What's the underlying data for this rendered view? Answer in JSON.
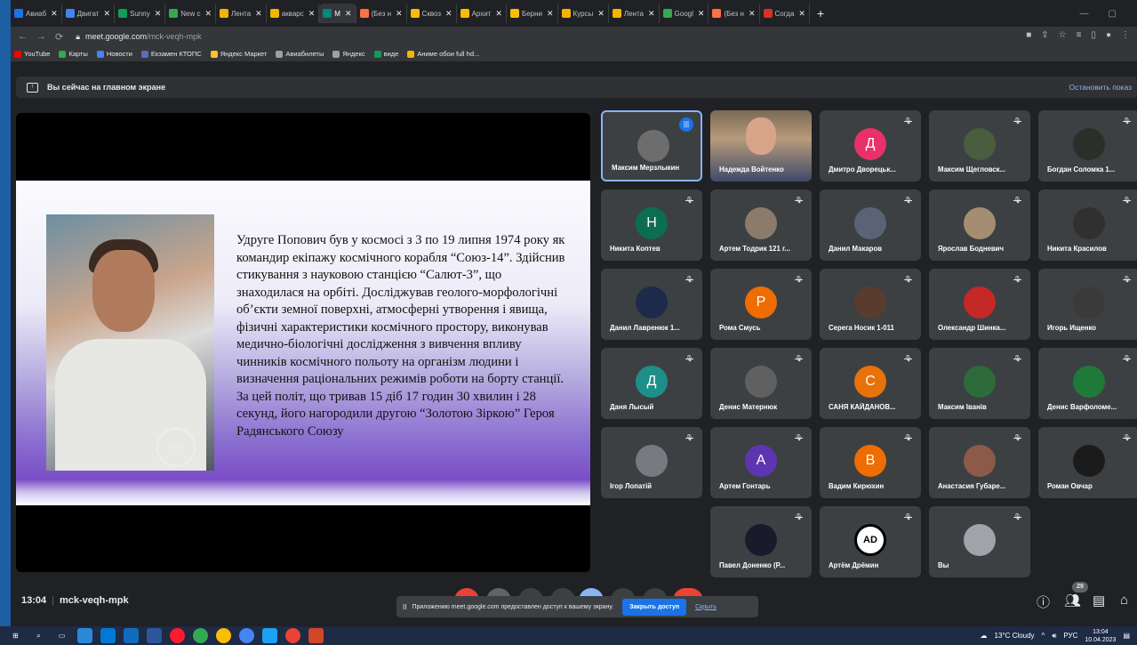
{
  "browser": {
    "tabs": [
      {
        "label": "Авиаб",
        "color": "#1a73e8"
      },
      {
        "label": "Двигат",
        "color": "#4285f4"
      },
      {
        "label": "Sunny",
        "color": "#0f9d58"
      },
      {
        "label": "New c",
        "color": "#34a853"
      },
      {
        "label": "Лента",
        "color": "#f4b400"
      },
      {
        "label": "акварс",
        "color": "#f4b400"
      },
      {
        "label": "M",
        "color": "#00897b",
        "active": true
      },
      {
        "label": "(Без н",
        "color": "#ff7043"
      },
      {
        "label": "Сквоз",
        "color": "#fbbc04"
      },
      {
        "label": "Архит",
        "color": "#fbbc04"
      },
      {
        "label": "Берни",
        "color": "#fbbc04"
      },
      {
        "label": "Курсы",
        "color": "#f4b400"
      },
      {
        "label": "Лента",
        "color": "#f4b400"
      },
      {
        "label": "Googl",
        "color": "#34a853"
      },
      {
        "label": "(Без н",
        "color": "#ff7043"
      },
      {
        "label": "Согда",
        "color": "#d93025"
      }
    ],
    "url_host": "meet.google.com",
    "url_path": "/mck-veqh-mpk",
    "bookmarks": [
      {
        "label": "YouTube",
        "color": "#ff0000"
      },
      {
        "label": "Карты",
        "color": "#34a853"
      },
      {
        "label": "Новости",
        "color": "#4285f4"
      },
      {
        "label": "Екзамен КТОПС",
        "color": "#5c6bc0"
      },
      {
        "label": "Яндекс Маркет",
        "color": "#fbc02d"
      },
      {
        "label": "Авиабилеты",
        "color": "#9aa0a6"
      },
      {
        "label": "Яндекс",
        "color": "#9aa0a6"
      },
      {
        "label": "виде",
        "color": "#0f9d58"
      },
      {
        "label": "Аниме обои full hd...",
        "color": "#f4b400"
      }
    ]
  },
  "banner": {
    "text": "Вы сейчас на главном экране",
    "stop": "Остановить показ"
  },
  "slide": {
    "text": "Удруге Попович був у космосі з 3 по 19 липня 1974 року як командир екіпажу космічного корабля “Союз-14”. Здійснив стикування з науковою станцією “Салют-3”, що знаходилася на орбіті. Досліджував геолого-морфологічні об’єкти земної поверхні, атмосферні утворення і явища, фізичні характеристики космічного простору, виконував медично-біологічні дослідження з вивчення впливу чинників космічного польоту на організм людини і визначення раціональних режимів роботи на борту станції. За цей політ, що тривав 15 діб 17 годин 30 хвилин і 28 секунд, його нагородили другою “Золотою Зіркою” Героя Радянського Союзу",
    "badge": "РОС КОСМОС"
  },
  "participants": [
    {
      "name": "Максим Мерзлыкин",
      "color": "#6d6d6d",
      "letter": "",
      "speaking": true
    },
    {
      "name": "Надежда Войтенко",
      "video": true
    },
    {
      "name": "Дмитро Дворецьк...",
      "color": "#e8306a",
      "letter": "Д"
    },
    {
      "name": "Максим Щегловск...",
      "color": "#4a5d3f",
      "letter": ""
    },
    {
      "name": "Богдан Соломка 1...",
      "color": "#2a2f2a",
      "letter": ""
    },
    {
      "name": "Никита Коптев",
      "color": "#0b6e4f",
      "letter": "Н"
    },
    {
      "name": "Артем Тодрик 121 г...",
      "color": "#8c7b6a",
      "letter": ""
    },
    {
      "name": "Данил Макаров",
      "color": "#5a6275",
      "letter": ""
    },
    {
      "name": "Ярослав Бодневич",
      "color": "#a58d73",
      "letter": ""
    },
    {
      "name": "Никита Красилов",
      "color": "#303030",
      "letter": ""
    },
    {
      "name": "Данил Лавренюк 1...",
      "color": "#1d2a4a",
      "letter": ""
    },
    {
      "name": "Рома Смусь",
      "color": "#ef6c00",
      "letter": "Р"
    },
    {
      "name": "Серега Носик 1-011",
      "color": "#5a3c2f",
      "letter": ""
    },
    {
      "name": "Олександр Шинка...",
      "color": "#c62828",
      "letter": ""
    },
    {
      "name": "Игорь Ищенко",
      "color": "#3a3a3a",
      "letter": ""
    },
    {
      "name": "Даня Лысый",
      "color": "#1e8e88",
      "letter": "Д"
    },
    {
      "name": "Денис Матернюк",
      "color": "#606060",
      "letter": ""
    },
    {
      "name": "САНЯ КАЙДАНОВ...",
      "color": "#e8710a",
      "letter": "С"
    },
    {
      "name": "Максим Івaнів",
      "color": "#2e6b3a",
      "letter": ""
    },
    {
      "name": "Денис Варфоломе...",
      "color": "#1f7a3a",
      "letter": ""
    },
    {
      "name": "Ігор Лопатій",
      "color": "#777b80",
      "letter": ""
    },
    {
      "name": "Артем Гонтарь",
      "color": "#5e35b1",
      "letter": "А"
    },
    {
      "name": "Вадим Кирюхин",
      "color": "#ef6c00",
      "letter": "В"
    },
    {
      "name": "Анастасия Губаре...",
      "color": "#8d5a48",
      "letter": ""
    },
    {
      "name": "Роман Овчар",
      "color": "#1b1b1b",
      "letter": ""
    },
    {
      "name": "Павел Доненко (Р...",
      "color": "#1a1a2a",
      "letter": ""
    },
    {
      "name": "Артём Дрёмин",
      "color": "#ffffff",
      "letter": "AD"
    },
    {
      "name": "Вы",
      "color": "#a0a4a8",
      "letter": ""
    }
  ],
  "meeting": {
    "time": "13:04",
    "code": "mck-veqh-mpk",
    "participant_count": "29"
  },
  "share_notice": {
    "text": "Приложению meet.google.com предоставлен доступ к вашему экрану.",
    "stop_button": "Закрыть доступ",
    "hide_link": "Скрыть"
  },
  "taskbar": {
    "weather": "13°C Cloudy",
    "lang": "РУС",
    "time": "13:04",
    "date": "10.04.2023"
  }
}
